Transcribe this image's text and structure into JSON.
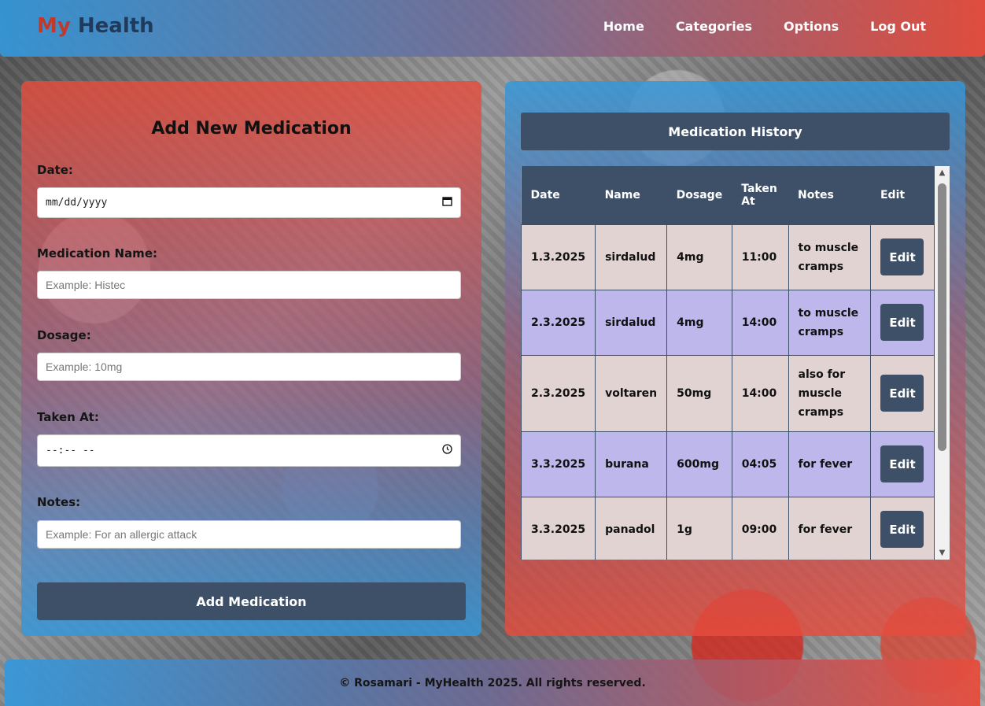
{
  "header": {
    "logo_my": "My",
    "logo_health": "Health",
    "nav": [
      "Home",
      "Categories",
      "Options",
      "Log Out"
    ]
  },
  "form": {
    "title": "Add New Medication",
    "date_label": "Date:",
    "date_value": "mm/dd/yyyy",
    "name_label": "Medication Name:",
    "name_placeholder": "Example: Histec",
    "dosage_label": "Dosage:",
    "dosage_placeholder": "Example: 10mg",
    "taken_label": "Taken At:",
    "taken_value": "--:-- --",
    "notes_label": "Notes:",
    "notes_placeholder": "Example: For an allergic attack",
    "submit_label": "Add Medication"
  },
  "history": {
    "title": "Medication History",
    "columns": [
      "Date",
      "Name",
      "Dosage",
      "Taken At",
      "Notes",
      "Edit"
    ],
    "rows": [
      {
        "date": "1.3.2025",
        "name": "sirdalud",
        "dosage": "4mg",
        "taken": "11:00",
        "notes": "to muscle cramps",
        "edit": "Edit"
      },
      {
        "date": "2.3.2025",
        "name": "sirdalud",
        "dosage": "4mg",
        "taken": "14:00",
        "notes": "to muscle cramps",
        "edit": "Edit"
      },
      {
        "date": "2.3.2025",
        "name": "voltaren",
        "dosage": "50mg",
        "taken": "14:00",
        "notes": "also for muscle cramps",
        "edit": "Edit"
      },
      {
        "date": "3.3.2025",
        "name": "burana",
        "dosage": "600mg",
        "taken": "04:05",
        "notes": "for fever",
        "edit": "Edit"
      },
      {
        "date": "3.3.2025",
        "name": "panadol",
        "dosage": "1g",
        "taken": "09:00",
        "notes": "for fever",
        "edit": "Edit"
      }
    ]
  },
  "footer": {
    "text": "© Rosamari - MyHealth 2025. All rights reserved."
  },
  "icons": {
    "date": "calendar-icon",
    "time": "clock-icon"
  },
  "colors": {
    "accent_dark": "#3e5068",
    "logo_red": "#c0392b",
    "logo_blue": "#1f3a5a",
    "row_odd": "#e0d3d1",
    "row_even": "#bdb7ec"
  }
}
